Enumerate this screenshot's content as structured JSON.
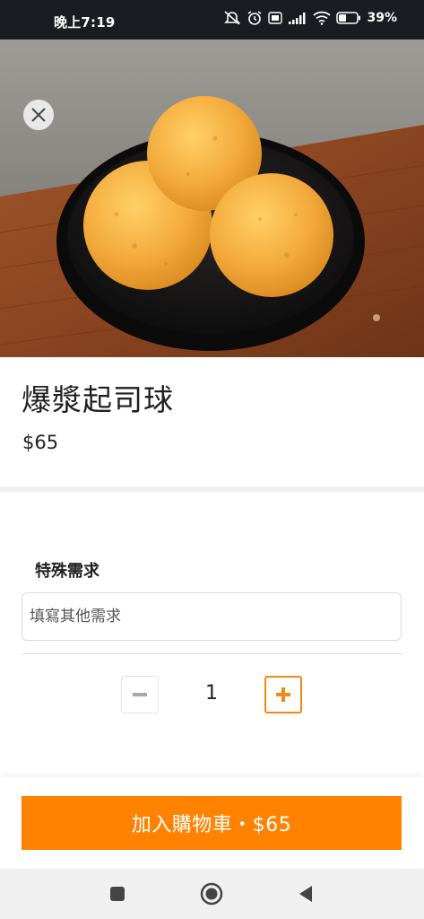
{
  "status_bar": {
    "time": "晚上7:19",
    "battery": "39%"
  },
  "product": {
    "name": "爆漿起司球",
    "price": "$65"
  },
  "special_requests": {
    "label": "特殊需求",
    "placeholder": "填寫其他需求",
    "value": ""
  },
  "quantity": {
    "value": "1",
    "minus": "−",
    "plus": "+"
  },
  "cart_button": {
    "label": "加入購物車・$65"
  },
  "colors": {
    "accent": "#ff8200",
    "status_bar": "#1b1c22"
  }
}
